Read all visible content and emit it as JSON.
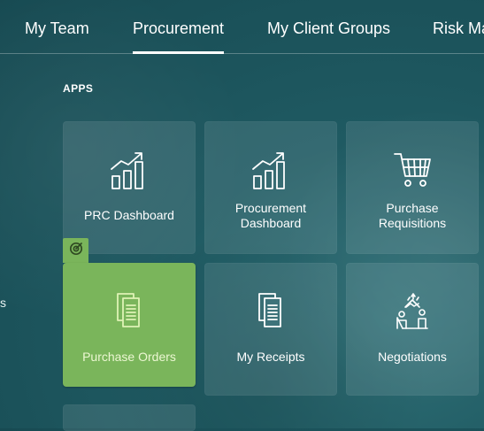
{
  "nav": {
    "tabs": [
      {
        "label": "My Team",
        "active": false
      },
      {
        "label": "Procurement",
        "active": true
      },
      {
        "label": "My Client Groups",
        "active": false
      },
      {
        "label": "Risk Ma",
        "active": false
      }
    ]
  },
  "side": {
    "fragment": "s"
  },
  "apps": {
    "section_title": "APPS",
    "tiles": [
      {
        "label": "PRC Dashboard",
        "icon": "chart-trend-icon"
      },
      {
        "label": "Procurement Dashboard",
        "icon": "chart-trend-icon"
      },
      {
        "label": "Purchase Requisitions",
        "icon": "shopping-cart-icon"
      },
      {
        "label": "Purchase Orders",
        "icon": "documents-icon",
        "selected": true
      },
      {
        "label": "My Receipts",
        "icon": "documents-icon"
      },
      {
        "label": "Negotiations",
        "icon": "negotiation-icon"
      }
    ],
    "selected_badge_icon": "target-icon"
  },
  "colors": {
    "background": "#1f5a62",
    "tile": "rgba(255,255,255,0.10)",
    "selected_tile": "#7ab55b",
    "selected_label": "#ecf7d2"
  }
}
